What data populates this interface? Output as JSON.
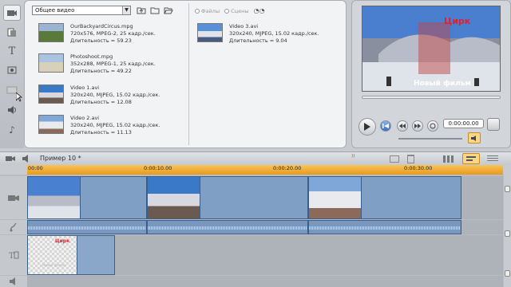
{
  "album": {
    "folder_select": "Общее видео",
    "radio_files": "Файлы",
    "radio_scenes": "Сцены",
    "clips": [
      {
        "name": "OurBackyardCircus.mpg",
        "info": "720x576, MPEG-2, 25 кадр./сек.",
        "duration": "Длительность = 59.23"
      },
      {
        "name": "Photoshoot.mpg",
        "info": "352x288, MPEG-1, 25 кадр./сек.",
        "duration": "Длительность = 49.22"
      },
      {
        "name": "Video 1.avi",
        "info": "320x240, MJPEG, 15.02 кадр./сек.",
        "duration": "Длительность = 12.08"
      },
      {
        "name": "Video 2.avi",
        "info": "320x240, MJPEG, 15.02 кадр./сек.",
        "duration": "Длительность = 11.13"
      },
      {
        "name": "Video 3.avi",
        "info": "320x240, MJPEG, 15.02 кадр./сек.",
        "duration": "Длительность = 9.04"
      }
    ]
  },
  "preview": {
    "title_text": "Цирк",
    "subtitle_text": "Новый фильм",
    "timecode": "0:00:00.00"
  },
  "timeline": {
    "project_name": "Пример 10 *",
    "ruler_marks": [
      "00:00",
      "0:00:10.00",
      "0:00:20.00",
      "0:00:30.00"
    ],
    "title_clip_text": "Цирк",
    "title_clip_subtext": "Новый фильм"
  },
  "colors": {
    "ruler": "#f0a830",
    "video_clip": "#7f9fc4",
    "title_red": "#e02030"
  },
  "icons": {
    "sidebar": [
      "video-icon",
      "transition-icon",
      "title-icon",
      "photo-icon",
      "menu-icon",
      "sound-icon",
      "music-icon"
    ],
    "toolbar": [
      "folder-up-icon",
      "folder-icon",
      "folder-open-icon"
    ],
    "player": [
      "play-icon",
      "rewind-icon",
      "fast-rewind-icon",
      "fast-forward-icon",
      "loop-icon",
      "volume-icon"
    ]
  }
}
